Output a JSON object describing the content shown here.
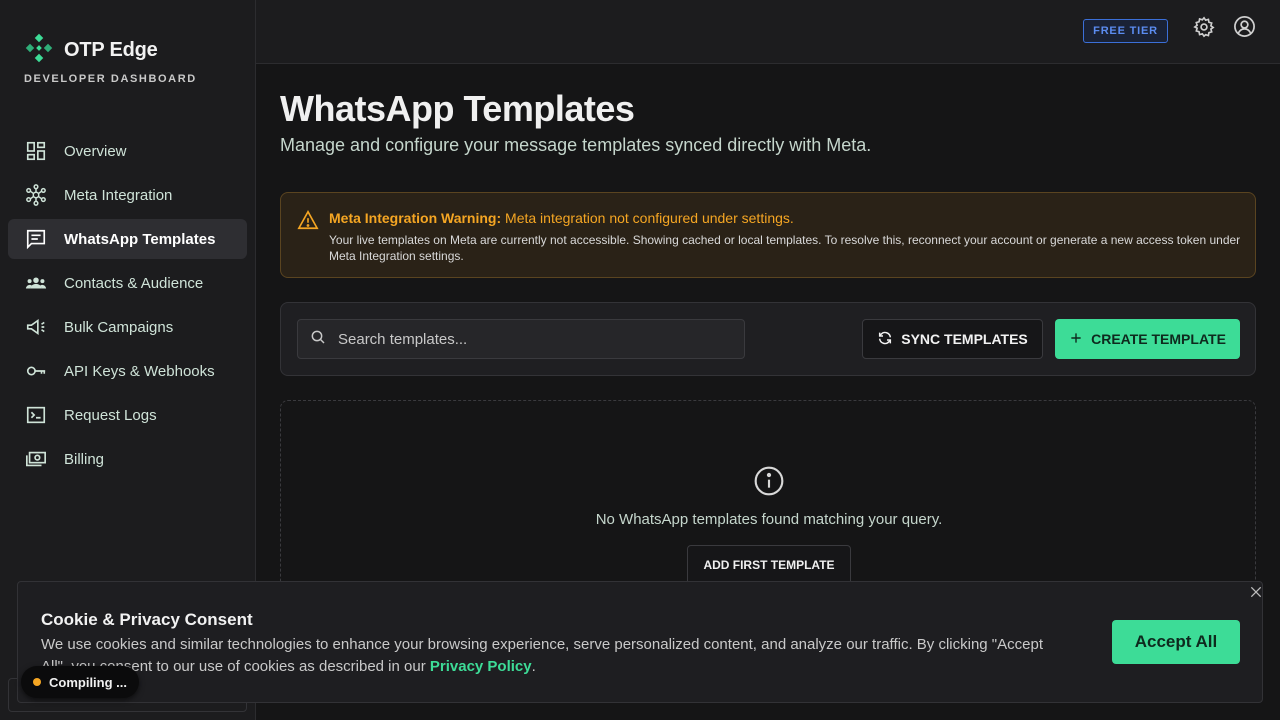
{
  "brand": {
    "name": "OTP Edge",
    "subtitle": "DEVELOPER DASHBOARD"
  },
  "sidebar": {
    "items": [
      {
        "label": "Overview",
        "icon": "dashboard-grid-icon",
        "active": false
      },
      {
        "label": "Meta Integration",
        "icon": "hub-network-icon",
        "active": false
      },
      {
        "label": "WhatsApp Templates",
        "icon": "message-template-icon",
        "active": true
      },
      {
        "label": "Contacts & Audience",
        "icon": "people-group-icon",
        "active": false
      },
      {
        "label": "Bulk Campaigns",
        "icon": "megaphone-icon",
        "active": false
      },
      {
        "label": "API Keys & Webhooks",
        "icon": "key-icon",
        "active": false
      },
      {
        "label": "Request Logs",
        "icon": "terminal-icon",
        "active": false
      },
      {
        "label": "Billing",
        "icon": "billing-money-icon",
        "active": false
      }
    ]
  },
  "topbar": {
    "tier_badge": "FREE TIER",
    "settings_icon": "gear-icon",
    "account_icon": "user-circle-icon"
  },
  "main": {
    "title": "WhatsApp Templates",
    "subtitle": "Manage and configure your message templates synced directly with Meta."
  },
  "warning": {
    "title_bold": "Meta Integration Warning:",
    "title_rest": "Meta integration not configured under settings.",
    "text": "Your live templates on Meta are currently not accessible. Showing cached or local templates. To resolve this, reconnect your account or generate a new access token under Meta Integration settings."
  },
  "toolbar": {
    "search_placeholder": "Search templates...",
    "sync_label": "SYNC TEMPLATES",
    "create_label": "CREATE TEMPLATE"
  },
  "empty_state": {
    "message": "No WhatsApp templates found matching your query.",
    "button_label": "ADD FIRST TEMPLATE"
  },
  "cookie": {
    "title": "Cookie & Privacy Consent",
    "text_before": "We use cookies and similar technologies to enhance your browsing experience, serve personalized content, and analyze our traffic. By clicking \"Accept All\", you consent to our use of cookies as described in our ",
    "link": "Privacy Policy",
    "text_after": ".",
    "accept_label": "Accept All"
  },
  "status_toast": {
    "label": "Compiling ..."
  },
  "colors": {
    "accent": "#3ddc97",
    "warning": "#f5a623",
    "tier_blue": "#5b8cf0",
    "background": "#151516"
  }
}
